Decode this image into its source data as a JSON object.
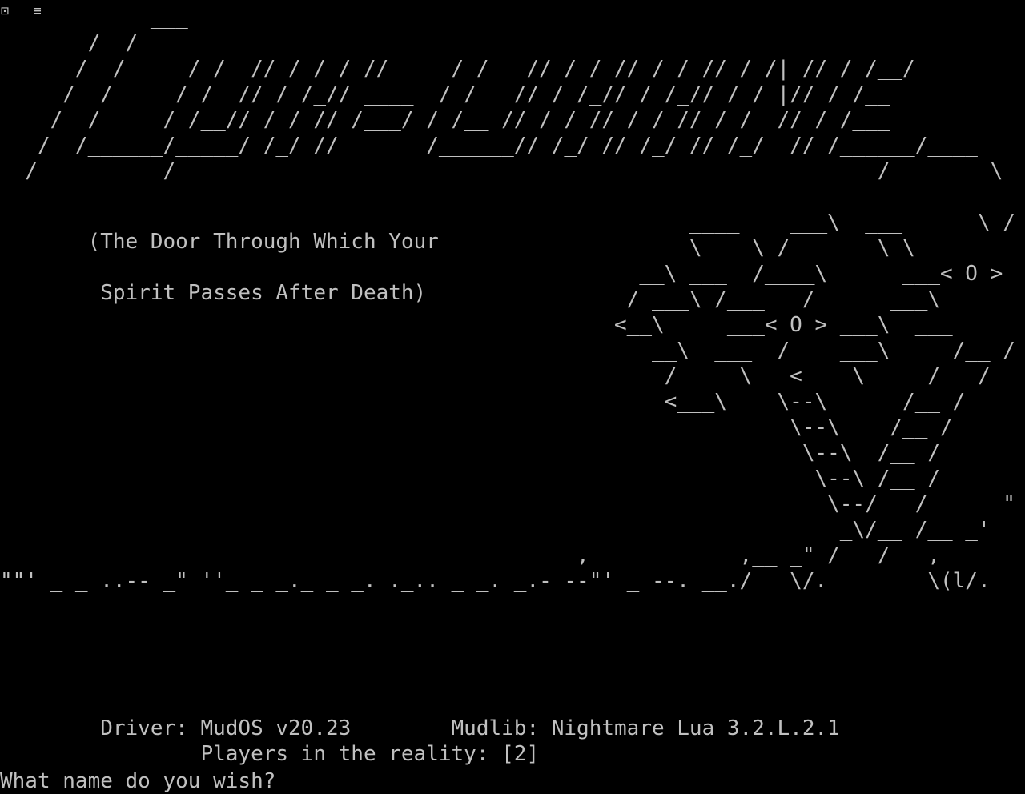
{
  "corner_icons": "⊡ ≡",
  "art": {
    "banner": [
      "            ___",
      "       /  /      __   _  _____      __    _  __  _  _____  __   _  _____",
      "      /  /     / /  // / / / //     / /   // / / // / / // / /| // / /__/",
      "     /  /     / /  // / /_// ____  / /   // / /_// / /_// / / |// / /__",
      "    /  /     / /__// / / // /___/ / /__ // / / // / / // / /  // / /___",
      "   /  /______/_____/ /_/ //       /______// /_/ // /_/ // /_/  // /______/____",
      "  /__________/                                                     ___/        \\    _"
    ],
    "right_lines": [
      "                                                       ____    ___\\  ___      \\ /",
      "                                                     __\\    \\ /    ___\\ \\___      _",
      "                                                   __\\ ___  /____\\      ___< O >",
      "                                                  / ___\\ /___   /      ___\\",
      "                                                 <__\\     ___< O > ___\\  ___",
      "                                                    __\\  ___  /    ___\\     /__ /",
      "                                                     /  ___\\   <____\\     /__ /",
      "                                                     <___\\    \\--\\      /__ /",
      "                                                               \\--\\    /__ /",
      "                                                                \\--\\  /__ /",
      "                                                                 \\--\\ /__ /",
      "                                                                  \\--/__ /     _\"",
      "                                                                   _\\/__ /__ _'",
      "                                              ,            ,__ _\" /   /   ,",
      "\"\"' _ _ ..-- _\" ''_ _ _._ _ _. ._.. _ _. _.- --\"' _ --. __./   \\/.        \\(l/."
    ]
  },
  "subtitle": {
    "line1": "       (The Door Through Which Your",
    "line2": "        Spirit Passes After Death)"
  },
  "info": {
    "driver_line": "        Driver: MudOS v20.23        Mudlib: Nightmare Lua 3.2.L.2.1",
    "players_line": "                Players in the reality: [2]"
  },
  "prompt": {
    "text": "What name do you wish? "
  }
}
